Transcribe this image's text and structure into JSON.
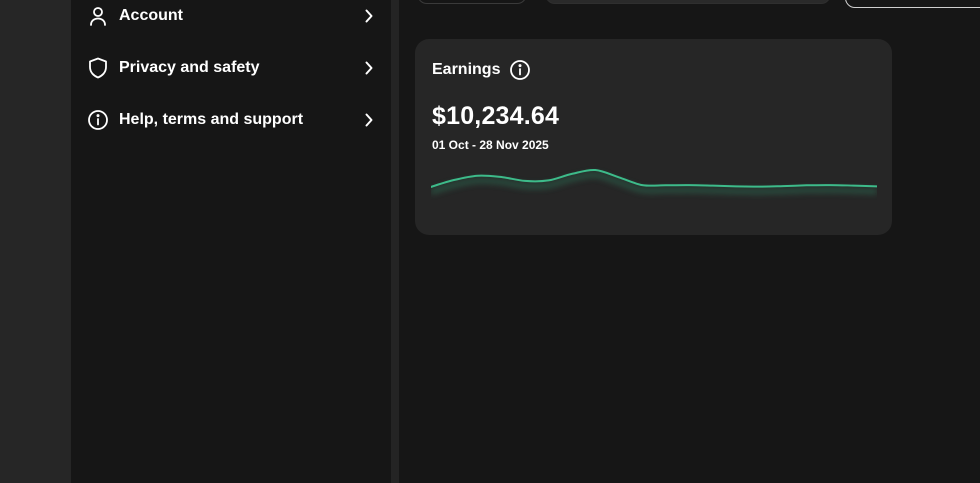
{
  "settings_menu": {
    "items": [
      {
        "label": "Account",
        "icon": "user-icon"
      },
      {
        "label": "Privacy and safety",
        "icon": "shield-icon"
      },
      {
        "label": "Help, terms and support",
        "icon": "info-icon"
      }
    ]
  },
  "earnings_card": {
    "title": "Earnings",
    "amount": "$10,234.64",
    "date_range": "01 Oct - 28 Nov 2025"
  },
  "colors": {
    "background": "#161616",
    "card": "#262626",
    "rail": "#262626",
    "line": "#3dbb8a",
    "text": "#ffffff"
  },
  "chart_data": {
    "type": "line",
    "values": [
      0.35,
      0.62,
      0.78,
      0.73,
      0.58,
      0.6,
      0.85,
      1.0,
      0.72,
      0.42,
      0.41,
      0.42,
      0.4,
      0.37,
      0.36,
      0.38,
      0.41,
      0.42,
      0.4,
      0.37
    ]
  }
}
